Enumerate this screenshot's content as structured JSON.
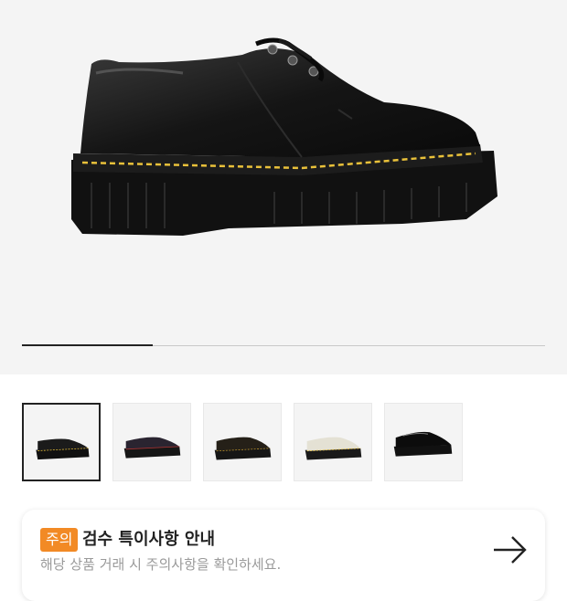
{
  "product": {
    "image_icon": "black-platform-derby-shoe",
    "gallery_progress": 0.25
  },
  "thumbnails": [
    {
      "color": "black-smooth",
      "selected": true
    },
    {
      "color": "black-red-hint",
      "selected": false
    },
    {
      "color": "black-brown-hint",
      "selected": false
    },
    {
      "color": "cream-white",
      "selected": false
    },
    {
      "color": "black-patent",
      "selected": false
    }
  ],
  "notice": {
    "badge": "주의",
    "title": "검수 특이사항 안내",
    "subtitle": "해당 상품 거래 시 주의사항을 확인하세요.",
    "arrow_icon": "arrow-right-icon"
  },
  "colors": {
    "accent": "#f28a25",
    "stitch": "#e9c13a"
  }
}
